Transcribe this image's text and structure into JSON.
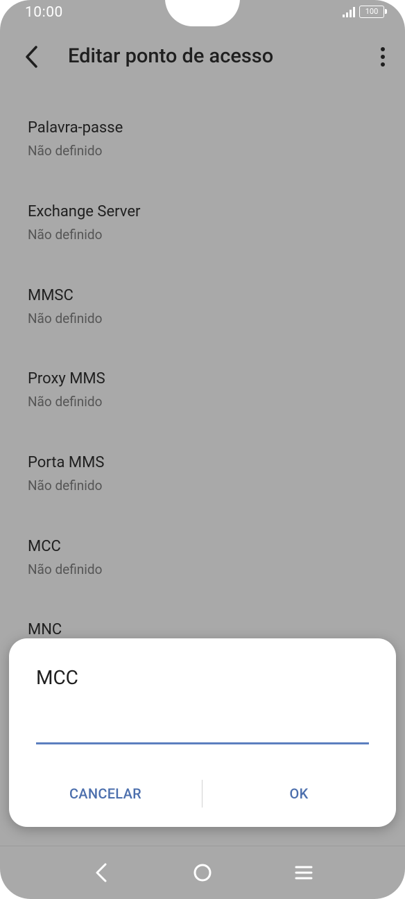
{
  "status_bar": {
    "time": "10:00",
    "battery": "100",
    "icons": [
      "signal-icon",
      "battery-icon"
    ]
  },
  "app_bar": {
    "title": "Editar ponto de acesso",
    "back_icon": "back-arrow-icon",
    "more_icon": "more-vert-icon"
  },
  "settings": [
    {
      "title": "Palavra-passe",
      "value": "Não definido"
    },
    {
      "title": "Exchange Server",
      "value": "Não definido"
    },
    {
      "title": "MMSC",
      "value": "Não definido"
    },
    {
      "title": "Proxy MMS",
      "value": "Não definido"
    },
    {
      "title": "Porta MMS",
      "value": "Não definido"
    },
    {
      "title": "MCC",
      "value": "Não definido"
    },
    {
      "title": "MNC",
      "value": ""
    }
  ],
  "dialog": {
    "title": "MCC",
    "input_value": "",
    "cancel_label": "CANCELAR",
    "ok_label": "OK"
  },
  "nav_bar": {
    "icons": [
      "nav-back-icon",
      "nav-home-icon",
      "nav-recents-icon"
    ]
  },
  "colors": {
    "scrim_background": "#a9a9a9",
    "accent": "#4c6fad",
    "input_underline": "#5b7fbf",
    "dialog_background": "#ffffff"
  }
}
